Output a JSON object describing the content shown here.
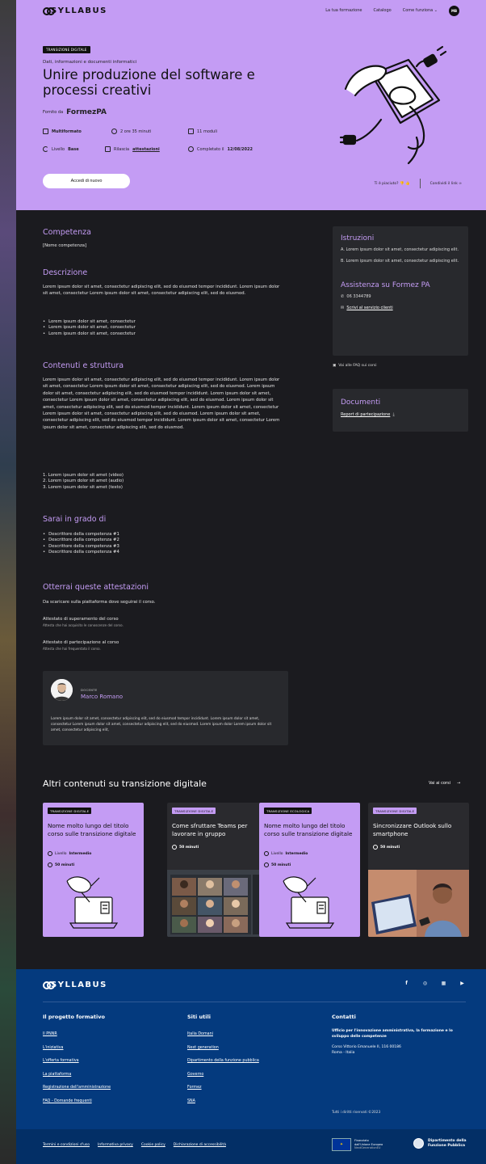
{
  "header": {
    "logo": "SYLLABUS",
    "nav": [
      "La tua formazione",
      "Catalogo",
      "Come funziona ⌄"
    ],
    "avatar": "MB"
  },
  "hero": {
    "tag": "TRANSIZIONE DIGITALE",
    "subtitle": "Dati, informazioni e documenti informatici",
    "title": "Unire produzione del software e processi creativi",
    "provided_by": "Fornito da",
    "provider": "FormezPA",
    "meta1": [
      {
        "icon": "multiformat-icon",
        "label": "Multiformato",
        "bold": true
      },
      {
        "icon": "clock-icon",
        "label": "2 ore 35 minuti"
      },
      {
        "icon": "modules-icon",
        "label": "11 moduli"
      }
    ],
    "meta2": [
      {
        "icon": "level-icon",
        "label": "Livello",
        "value": "Base"
      },
      {
        "icon": "certificate-icon",
        "label": "Rilascia",
        "value": "attestazioni"
      },
      {
        "icon": "check-icon",
        "label": "Completato il",
        "value": "12/08/2022"
      }
    ],
    "access_button": "Accedi di nuovo",
    "like_label": "Ti è piaciuto?",
    "share_label": "Condividi il link"
  },
  "main": {
    "competenza_title": "Competenza",
    "competenza_value": "[Nome competenza]",
    "descrizione_title": "Descrizione",
    "descrizione_text": "Lorem ipsum dolor sit amet, consectetur adipiscing elit, sed do eiusmod tempor incididunt. Lorem ipsum dolor sit amet, consectetur Lorem ipsum dolor sit amet, consectetur adipiscing elit, sed do eiusmod.",
    "descrizione_list": [
      "Lorem ipsum dolor sit amet, consectetur",
      "Lorem ipsum dolor sit amet, consectetur",
      "Lorem ipsum dolor sit amet, consectetur"
    ],
    "contenuti_title": "Contenuti e struttura",
    "contenuti_text": "Lorem ipsum dolor sit amet, consectetur adipiscing elit, sed do eiusmod tempor incididunt. Lorem ipsum dolor sit amet, consectetur Lorem ipsum dolor sit amet, consectetur adipiscing elit, sed do eiusmod. Lorem ipsum dolor sit amet, consectetur adipiscing elit, sed do eiusmod tempor incididunt. Lorem ipsum dolor sit amet, consectetur Lorem ipsum dolor sit amet, consectetur adipiscing elit, sed do eiusmod. Lorem ipsum dolor sit amet, consectetur adipiscing elit, sed do eiusmod tempor incididunt. Lorem ipsum dolor sit amet, consectetur Lorem ipsum dolor sit amet, consectetur adipiscing elit, sed do eiusmod. Lorem ipsum dolor sit amet, consectetur adipiscing elit, sed do eiusmod tempor incididunt. Lorem ipsum dolor sit amet, consectetur Lorem ipsum dolor sit amet, consectetur adipiscing elit, sed do eiusmod.",
    "contenuti_list": [
      "1. Lorem ipsum dolor sit amet (video)",
      "2. Lorem ipsum dolor sit amet (audio)",
      "3. Lorem ipsum dolor sit amet (testo)"
    ],
    "sarai_title": "Sarai in grado di",
    "sarai_list": [
      "Descrittore della competenza #1",
      "Descrittore della competenza #2",
      "Descrittore della competenza #3",
      "Descrittore della competenza #4"
    ],
    "attestazioni_title": "Otterrai queste attestazioni",
    "attestazioni_text": "Da scaricare sulla piattaforma dove seguirai il corso.",
    "att1_title": "Attestato di superamento del corso",
    "att1_sub": "Attesta che hai acquisito le conoscenze del corso.",
    "att2_title": "Attestato di partecipazione al corso",
    "att2_sub": "Attesta che hai frequentato il corso.",
    "docente_label": "DOCENTE",
    "docente_name": "Marco Romano",
    "docente_desc": "Lorem ipsum dolor sit amet, consectetur adipiscing elit, sed do eiusmod tempor incididunt. Lorem ipsum dolor sit amet, consectetur Lorem ipsum dolor sit amet, consectetur adipiscing elit, sed do eiusmod. Lorem ipsum dolor Lorem ipsum dolor sit amet, consectetur adipiscing elit,"
  },
  "sidebar": {
    "istruzioni_title": "Istruzioni",
    "istruzioni_a": "A. Lorem ipsum dolor sit amet, consectetur adipiscing elit.",
    "istruzioni_b": "B. Lorem ipsum dolor sit amet, consectetur adipiscing elit.",
    "assistenza_title": "Assistenza su Formez PA",
    "phone": "06 3344789",
    "write_link": "Scrivi al servizio clienti",
    "faq_link": "Vai alle FAQ sui corsi",
    "documenti_title": "Documenti",
    "report_link": "Report di partecipazione"
  },
  "related": {
    "title": "Altri contenuti su transizione digitale",
    "link": "Vai ai corsi",
    "cards": [
      {
        "tag": "TRANSIZIONE DIGITALE",
        "title": "Nome molto lungo del titolo corso sulle transizione digitale",
        "level_label": "Livello",
        "level": "Intermedio",
        "duration": "50 minuti"
      },
      {
        "tag": "TRANSIZIONE DIGITALE",
        "title": "Come sfruttare Teams per lavorare in gruppo",
        "duration": "50 minuti"
      },
      {
        "tag": "TRANSIZIONE ECOLOGICA",
        "title": "Nome molto lungo del titolo corso sulle transizione digitale",
        "level_label": "Livello",
        "level": "Intermedio",
        "duration": "50 minuti"
      },
      {
        "tag": "TRANSIZIONE DIGITALE",
        "title": "Sincronizzare Outlook sullo smartphone",
        "duration": "50 minuti"
      }
    ]
  },
  "footer": {
    "logo": "SYLLABUS",
    "col1_title": "Il progetto formativo",
    "col1_links": [
      "Il PNNR",
      "L'iniziativa",
      "L'offerta formativa",
      "La piattaforma",
      "Registrazione dell'amministrazione",
      "FAQ - Domande frequenti"
    ],
    "col2_title": "Siti utili",
    "col2_links": [
      "Italia Domani",
      "Next generation",
      "Dipartimento della funzione pubblica",
      "Governo",
      "Formez",
      "SNA"
    ],
    "col3_title": "Contatti",
    "contact_office": "Ufficio per l'innovazione amministrativa, la formazione e lo sviluppo delle competenze",
    "contact_address": "Corso Vittorio Emanuele II, 116 00186 Roma - Italia",
    "rights": "Tutti i diritti riservati ©2023",
    "bottom_links": [
      "Termini e condizioni d'uso",
      "Informativa privacy",
      "Cookie policy",
      "Dichiarazione di accessibilità"
    ],
    "eu_text1": "Finanziato",
    "eu_text2": "dall'Unione Europea",
    "eu_text3": "NextGenerationEU",
    "dfp_text1": "Dipartimento della",
    "dfp_text2": "Funzione Pubblica"
  },
  "colors": {
    "accent": "#c49cf4",
    "background": "#1b1b1f",
    "footer": "#043a7e"
  }
}
